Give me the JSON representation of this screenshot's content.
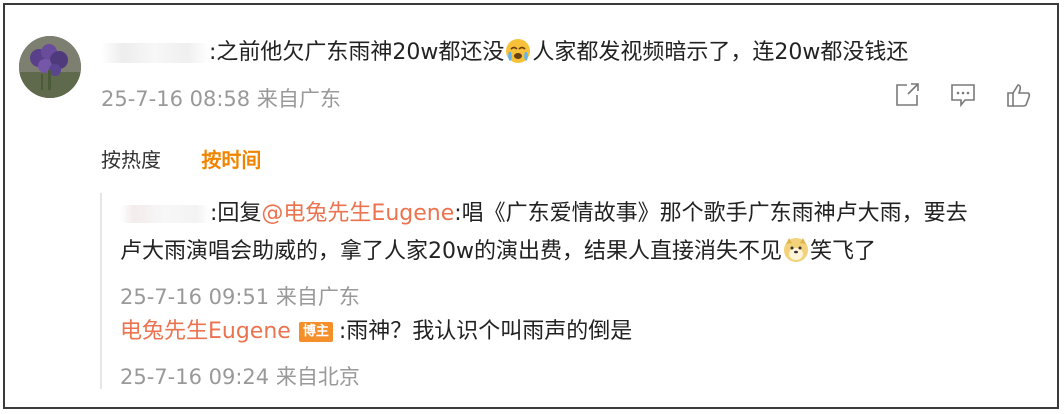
{
  "comment": {
    "text_pre": ":之前他欠广东雨神20w都还没",
    "text_post": "人家都发视频暗示了，连20w都没钱还",
    "emoji": "crying-face-emoji",
    "meta": "25-7-16 08:58 来自广东"
  },
  "actions": {
    "share_icon": "share-icon",
    "comment_icon": "comment-icon",
    "like_icon": "thumbs-up-icon"
  },
  "sort": {
    "by_heat": "按热度",
    "by_time": "按时间"
  },
  "replies": [
    {
      "reply_prefix": ":回复",
      "mention": "@电兔先生Eugene",
      "text_a": ":唱《广东爱情故事》那个歌手广东雨神卢大雨，要去",
      "text_b": "卢大雨演唱会助威的，拿了人家20w的演出费，结果人直接消失不见",
      "text_c": "笑飞了",
      "emoji": "doge-emoji",
      "meta": "25-7-16 09:51 来自广东"
    },
    {
      "author": "电兔先生Eugene",
      "badge": "博主",
      "text": ":雨神？我认识个叫雨声的倒是",
      "meta": "25-7-16 09:24 来自北京"
    }
  ],
  "colors": {
    "accent": "#f08400",
    "link": "#eb7350",
    "badge": "#f58f2a",
    "meta": "#999999"
  }
}
